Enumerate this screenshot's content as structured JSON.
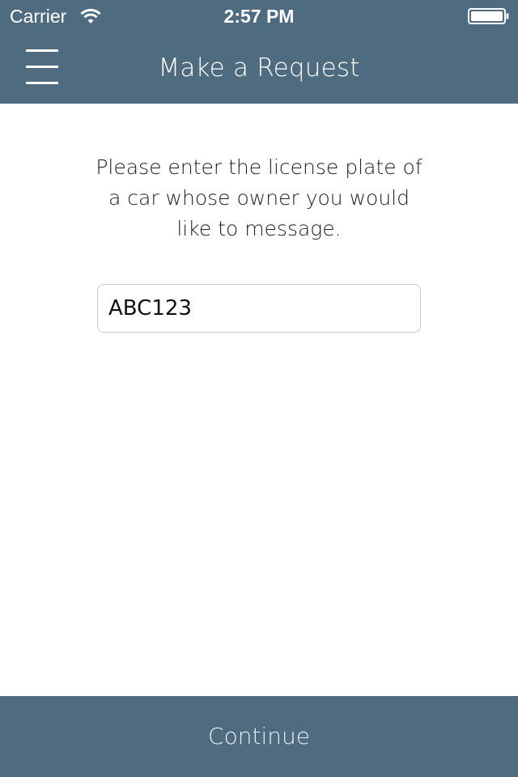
{
  "status_bar": {
    "carrier": "Carrier",
    "time": "2:57 PM",
    "wifi_icon": "wifi-icon",
    "battery_icon": "battery-icon"
  },
  "nav_bar": {
    "title": "Make a Request",
    "menu_icon": "hamburger-menu-icon"
  },
  "main": {
    "instruction": "Please enter the license plate of a car whose owner you would like to message.",
    "plate_input": {
      "value": "ABC123",
      "placeholder": ""
    }
  },
  "footer": {
    "continue_label": "Continue"
  },
  "colors": {
    "bar_background": "#4f6b80",
    "text_on_bar": "#ffffff",
    "content_background": "#ffffff"
  }
}
